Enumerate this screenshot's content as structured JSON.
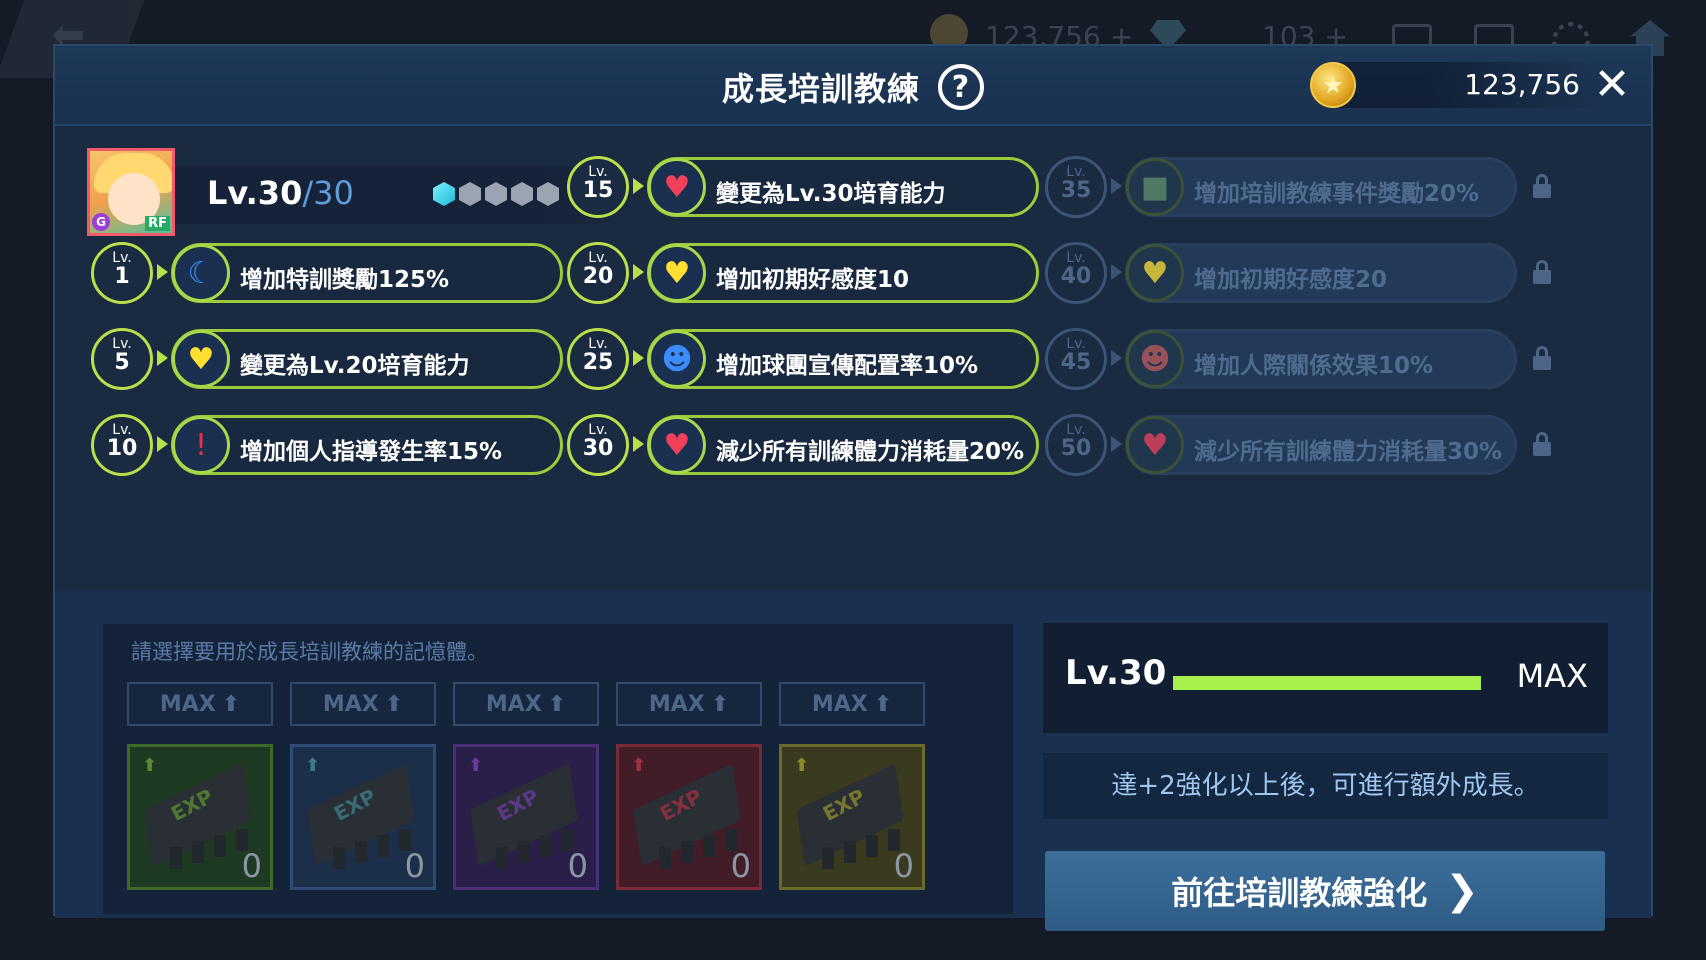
{
  "header": {
    "title": "成長培訓教練",
    "help_icon": "?",
    "coins": "123,756",
    "close_icon": "✕"
  },
  "background_bar": {
    "coins": "123,756 +",
    "gems": "103 +"
  },
  "player": {
    "level": "Lv.30",
    "level_max": "/30",
    "rarity_badge": "G",
    "position_badge": "RF",
    "enhance_dots_total": 5,
    "enhance_dots_active": 1
  },
  "skills": {
    "col1": [
      {
        "lv": "1",
        "icon": "moon-plus-icon",
        "text": "增加特訓獎勵125%"
      },
      {
        "lv": "5",
        "icon": "heart-icon",
        "text": "變更為Lv.20培育能力"
      },
      {
        "lv": "10",
        "icon": "exclamation-card-icon",
        "text": "增加個人指導發生率15%"
      }
    ],
    "col2": [
      {
        "lv": "15",
        "icon": "heart-minus-icon",
        "text": "變更為Lv.30培育能力"
      },
      {
        "lv": "20",
        "icon": "heart-icon",
        "text": "增加初期好感度10"
      },
      {
        "lv": "25",
        "icon": "person-check-icon",
        "text": "增加球團宣傳配置率10%"
      },
      {
        "lv": "30",
        "icon": "heart-minus-icon",
        "text": "減少所有訓練體力消耗量20%"
      }
    ],
    "col3": [
      {
        "lv": "35",
        "icon": "chat-icon",
        "text": "增加培訓教練事件獎勵20%"
      },
      {
        "lv": "40",
        "icon": "heart-icon",
        "text": "增加初期好感度20"
      },
      {
        "lv": "45",
        "icon": "people-icon",
        "text": "增加人際關係效果10%"
      },
      {
        "lv": "50",
        "icon": "heart-minus-icon",
        "text": "減少所有訓練體力消耗量30%"
      }
    ],
    "lv_prefix": "Lv."
  },
  "memory": {
    "prompt": "請選擇要用於成長培訓教練的記憶體。",
    "chip_label": "EXP",
    "slots": [
      {
        "max_label": "MAX",
        "count": "0",
        "color": "#3d6a2a",
        "bg": "#1f3a22",
        "text_color": "#5a8a32"
      },
      {
        "max_label": "MAX",
        "count": "0",
        "color": "#2f4c78",
        "bg": "#1b2e4a",
        "text_color": "#3d7a86"
      },
      {
        "max_label": "MAX",
        "count": "0",
        "color": "#4b2f78",
        "bg": "#2a1f48",
        "text_color": "#6a3aa0"
      },
      {
        "max_label": "MAX",
        "count": "0",
        "color": "#7a2a36",
        "bg": "#421c26",
        "text_color": "#a03040"
      },
      {
        "max_label": "MAX",
        "count": "0",
        "color": "#6a6a2a",
        "bg": "#3a3a1f",
        "text_color": "#8a8a2a"
      }
    ]
  },
  "progress": {
    "level": "Lv.30",
    "fill_fraction": 1.0,
    "max_label": "MAX"
  },
  "notice": "達+2強化以上後，可進行額外成長。",
  "go_button": "前往培訓教練強化",
  "colors": {
    "accent_green": "#b8e04a",
    "progress_green": "#a6f04c",
    "locked": "#3b5478"
  }
}
